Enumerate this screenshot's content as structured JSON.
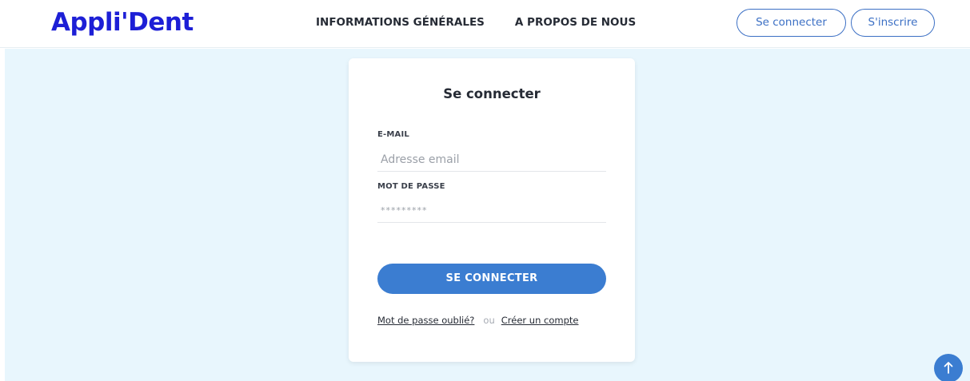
{
  "header": {
    "logo": "Appli'Dent",
    "nav": [
      "INFORMATIONS GÉNÉRALES",
      "A PROPOS DE NOUS"
    ],
    "login_button": "Se connecter",
    "signup_button": "S'inscrire"
  },
  "login_form": {
    "title": "Se connecter",
    "email_label": "E-MAIL",
    "email_placeholder": "Adresse email",
    "password_label": "MOT DE PASSE",
    "password_value": "*********",
    "submit_label": "SE CONNECTER",
    "forgot_password": "Mot de passe oublié?",
    "or_text": "ou",
    "create_account": "Créer un compte"
  },
  "colors": {
    "brand": "#1d1fd6",
    "accent": "#3b7dd1",
    "background": "#e8f6fd"
  },
  "icons": {
    "scroll_top": "arrow-up-icon"
  }
}
